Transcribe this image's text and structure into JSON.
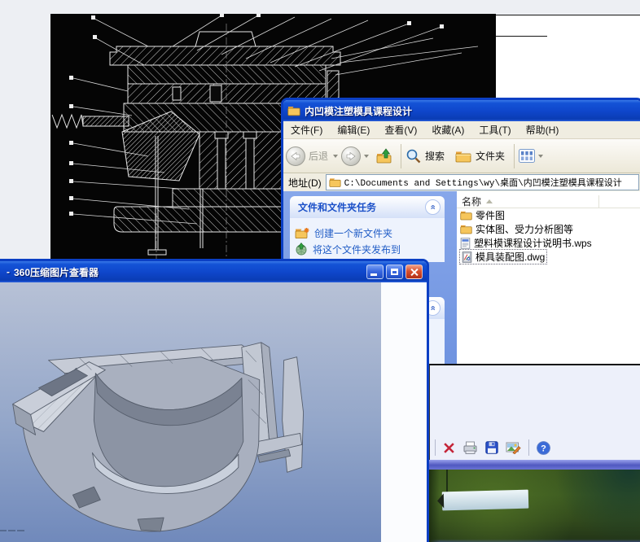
{
  "explorer": {
    "title": "内凹模注塑模具课程设计",
    "menu": {
      "file": "文件(F)",
      "edit": "编辑(E)",
      "view": "查看(V)",
      "favorites": "收藏(A)",
      "tools": "工具(T)",
      "help": "帮助(H)"
    },
    "toolbar": {
      "back_label": "后退",
      "search_label": "搜索",
      "folders_label": "文件夹"
    },
    "address": {
      "label": "地址(D)",
      "value": "C:\\Documents and Settings\\wy\\桌面\\内凹模注塑模具课程设计"
    },
    "task_pane": {
      "group_title": "文件和文件夹任务",
      "item_new_folder": "创建一个新文件夹",
      "item_publish": "将这个文件夹发布到",
      "chevron": "«"
    },
    "file_list": {
      "name_column": "名称",
      "rows": [
        {
          "name": "零件图",
          "icon": "folder"
        },
        {
          "name": "实体图、受力分析图等",
          "icon": "folder"
        },
        {
          "name": "塑料模课程设计说明书.wps",
          "icon": "wps-document"
        },
        {
          "name": "模具装配图.dwg",
          "icon": "dwg-drawing",
          "selected": true
        }
      ]
    }
  },
  "viewer": {
    "title_prefix": "-",
    "title": "360压缩图片查看器"
  },
  "tool_panel": {
    "icons": [
      "delete",
      "print",
      "save",
      "image-edit",
      "help"
    ],
    "help_glyph": "?"
  },
  "cad_window": {
    "content": "injection-mold-assembly-section-drawing"
  },
  "colors": {
    "titlebar_blue": "#0f47cc",
    "window_border": "#0b3fc4",
    "task_pane_blue": "#7da0e6",
    "link_blue": "#215dc6",
    "close_red": "#d0442a",
    "view3d_top": "#b7c1d6",
    "view3d_bottom": "#7089bb"
  }
}
